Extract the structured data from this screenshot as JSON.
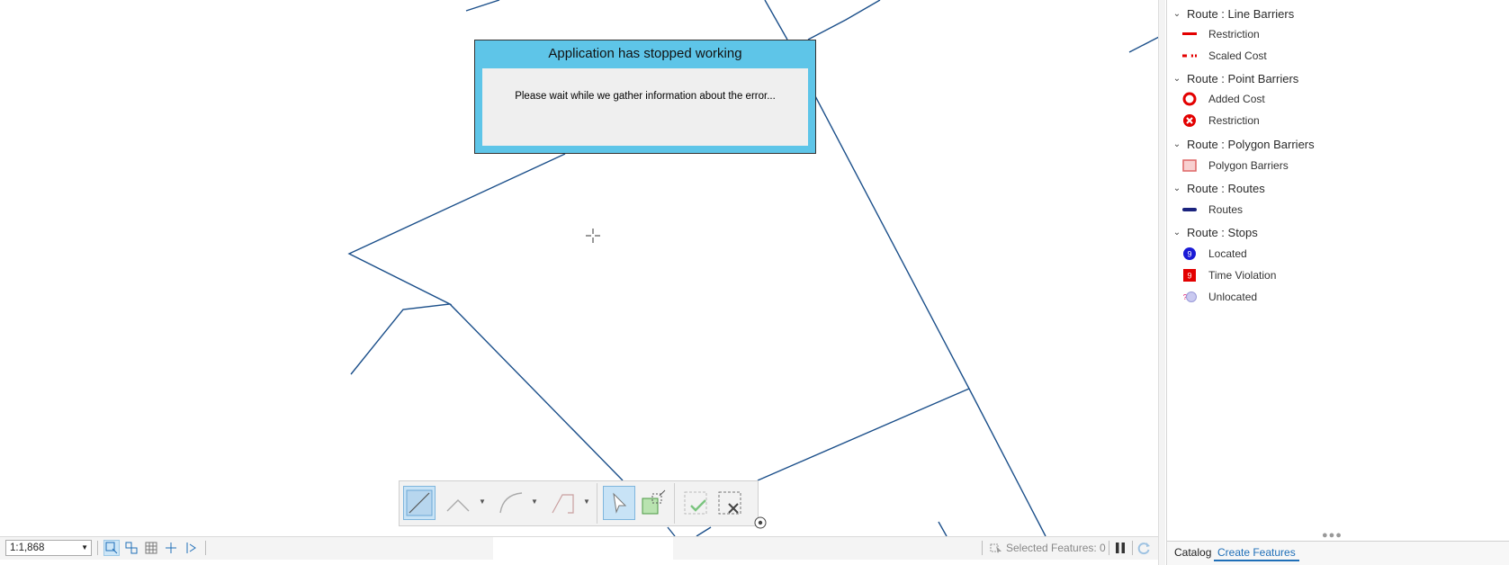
{
  "dialog": {
    "title": "Application has stopped working",
    "message": "Please wait while we gather information about the error..."
  },
  "legend": {
    "groups": [
      {
        "label": "Route : Line Barriers",
        "items": [
          {
            "label": "Restriction",
            "icon": "red-line-icon"
          },
          {
            "label": "Scaled Cost",
            "icon": "red-dashed-line-icon"
          }
        ]
      },
      {
        "label": "Route : Point Barriers",
        "items": [
          {
            "label": "Added Cost",
            "icon": "red-ring-icon"
          },
          {
            "label": "Restriction",
            "icon": "red-x-circle-icon"
          }
        ]
      },
      {
        "label": "Route : Polygon Barriers",
        "items": [
          {
            "label": "Polygon Barriers",
            "icon": "pink-rect-icon"
          }
        ]
      },
      {
        "label": "Route : Routes",
        "items": [
          {
            "label": "Routes",
            "icon": "navy-line-icon"
          }
        ]
      },
      {
        "label": "Route : Stops",
        "items": [
          {
            "label": "Located",
            "icon": "blue-stop-icon"
          },
          {
            "label": "Time Violation",
            "icon": "red-stop-icon"
          },
          {
            "label": "Unlocated",
            "icon": "unlocated-stop-icon"
          }
        ]
      }
    ]
  },
  "tabs": {
    "catalog": "Catalog",
    "create_features": "Create Features"
  },
  "status": {
    "scale": "1:1,868",
    "selected_features": "Selected Features: 0"
  },
  "colors": {
    "route_line": "#1b4f8a",
    "dialog_frame": "#5ec5e8",
    "accent": "#1f6fb8"
  }
}
